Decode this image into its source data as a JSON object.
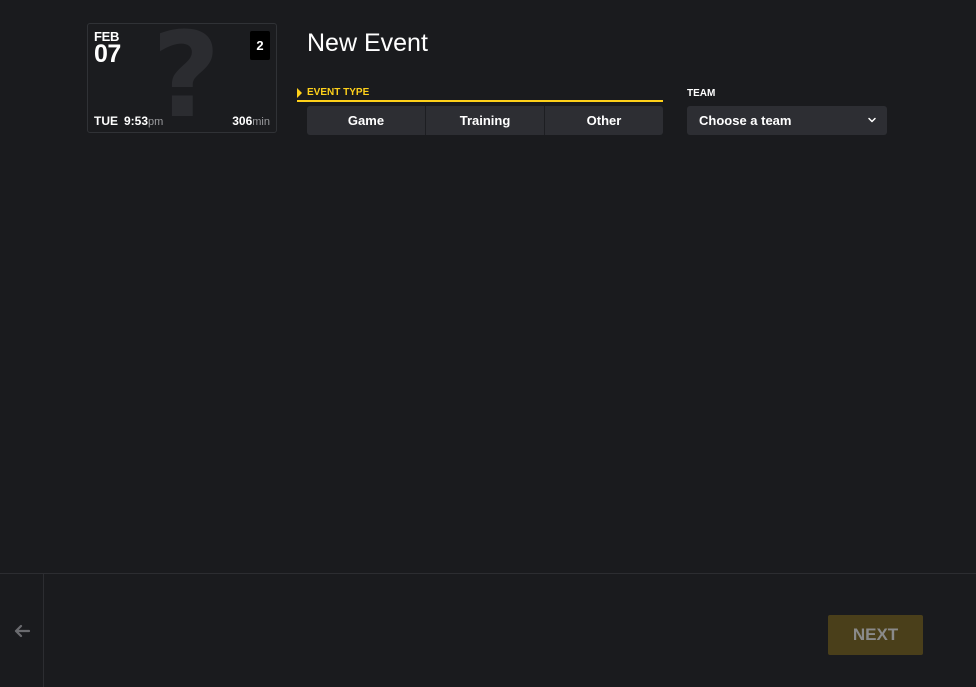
{
  "card": {
    "month": "FEB",
    "day": "07",
    "badge": "2",
    "weekday": "TUE",
    "time": "9:53",
    "ampm": "pm",
    "duration": "306",
    "duration_unit": "min",
    "placeholder_glyph": "?"
  },
  "header": {
    "title": "New Event"
  },
  "event_type": {
    "label": "EVENT TYPE",
    "options": [
      "Game",
      "Training",
      "Other"
    ],
    "accent": "#ffd11a"
  },
  "team": {
    "label": "TEAM",
    "placeholder": "Choose a team"
  },
  "footer": {
    "next_label": "NEXT",
    "back_icon": "arrow-left-icon"
  },
  "colors": {
    "background": "#1a1b1e",
    "accent": "#ffd11a",
    "control_bg": "#2d2e33"
  }
}
